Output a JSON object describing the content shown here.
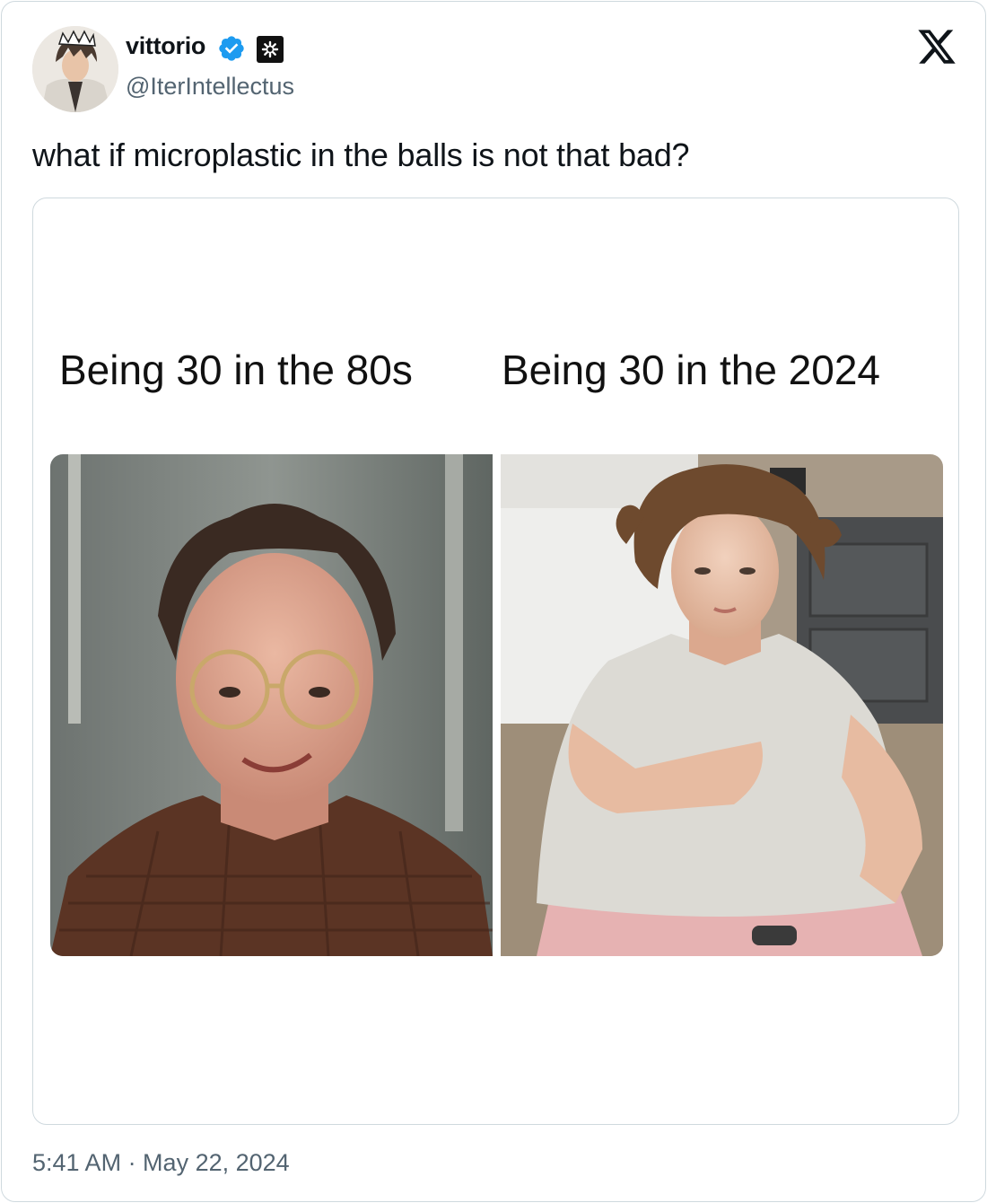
{
  "author": {
    "display_name": "vittorio",
    "handle": "@IterIntellectus",
    "verified": true
  },
  "tweet": {
    "text": "what if microplastic in the balls is not that bad?",
    "timestamp": "5:41 AM · May 22, 2024"
  },
  "media": {
    "captions": {
      "left": "Being 30 in the 80s",
      "right": "Being 30 in the 2024"
    }
  },
  "icons": {
    "verified": "verified-badge-icon",
    "affiliation": "affiliation-badge-icon",
    "platform": "x-logo-icon"
  },
  "colors": {
    "verified_blue": "#1d9bf0",
    "text_primary": "#0f1419",
    "text_secondary": "#536471",
    "border": "#cfd9de"
  }
}
